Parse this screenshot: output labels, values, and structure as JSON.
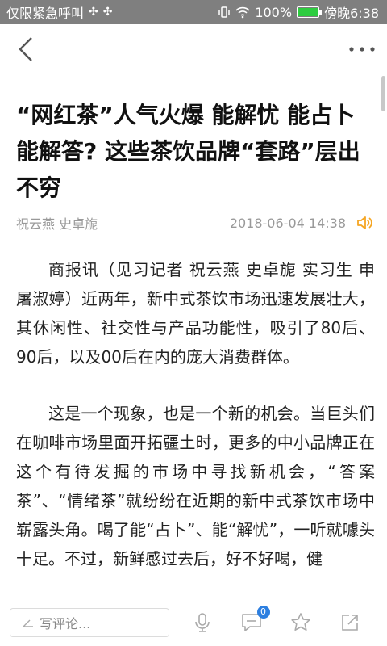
{
  "status_bar": {
    "left_text": "仅限紧急呼叫",
    "battery_percent": "100%",
    "time": "傍晚6:38",
    "battery_level": 1.0
  },
  "nav": {
    "back_icon": "chevron-left-icon",
    "more_icon": "more-horizontal-icon"
  },
  "article": {
    "title": "“网红茶”人气火爆 能解忧 能占卜能解答? 这些茶饮品牌“套路”层出不穷",
    "authors": "祝云燕 史卓旎",
    "timestamp": "2018-06-04 14:38",
    "paragraphs": [
      "商报讯（见习记者 祝云燕 史卓旎 实习生 申屠淑婷）近两年，新中式茶饮市场迅速发展壮大，其休闲性、社交性与产品功能性，吸引了80后、90后，以及00后在内的庞大消费群体。",
      "这是一个现象，也是一个新的机会。当巨头们在咖啡市场里面开拓疆土时，更多的中小品牌正在这个有待发掘的市场中寻找新机会，“答案茶”、“情绪茶”就纷纷在近期的新中式茶饮市场中崭露头角。喝了能“占卜”、能“解忧”，一听就噱头十足。不过，新鲜感过去后，好不好喝，健"
    ]
  },
  "bottom_bar": {
    "comment_placeholder": "写评论...",
    "comment_count": "0"
  },
  "colors": {
    "accent": "#2d7fe0",
    "speaker": "#f5a623",
    "status_bar_bg": "#7f7f7f"
  }
}
